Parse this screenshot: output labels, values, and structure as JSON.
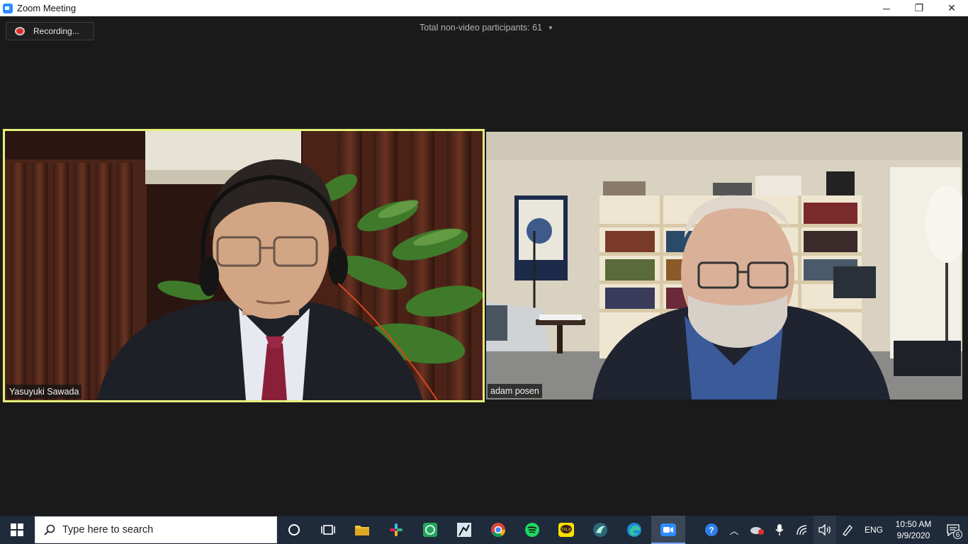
{
  "window": {
    "title": "Zoom Meeting",
    "controls": {
      "minimize": "─",
      "restore": "❐",
      "close": "✕"
    }
  },
  "meeting": {
    "recording_label": "Recording...",
    "participants_label": "Total non-video participants: 61",
    "tiles": [
      {
        "name": "Yasuyuki Sawada",
        "active_speaker": true
      },
      {
        "name": "adam posen",
        "active_speaker": false
      }
    ]
  },
  "taskbar": {
    "search_placeholder": "Type here to search",
    "apps": [
      "cortana-icon",
      "task-view-icon",
      "file-explorer-icon",
      "slack-icon",
      "whatsapp-icon",
      "kindle-icon",
      "chrome-icon",
      "spotify-icon",
      "kakaotalk-icon",
      "bird-app-icon",
      "edge-icon",
      "zoom-icon"
    ],
    "kakao_label": "TALK",
    "tray": {
      "language": "ENG",
      "time": "10:50 AM",
      "date": "9/9/2020",
      "notification_count": "6"
    }
  },
  "colors": {
    "active_speaker_border": "#e4f07a",
    "meeting_background": "#1a1a1a",
    "taskbar": "#1f2a3a",
    "recording_dot": "#e02828"
  }
}
